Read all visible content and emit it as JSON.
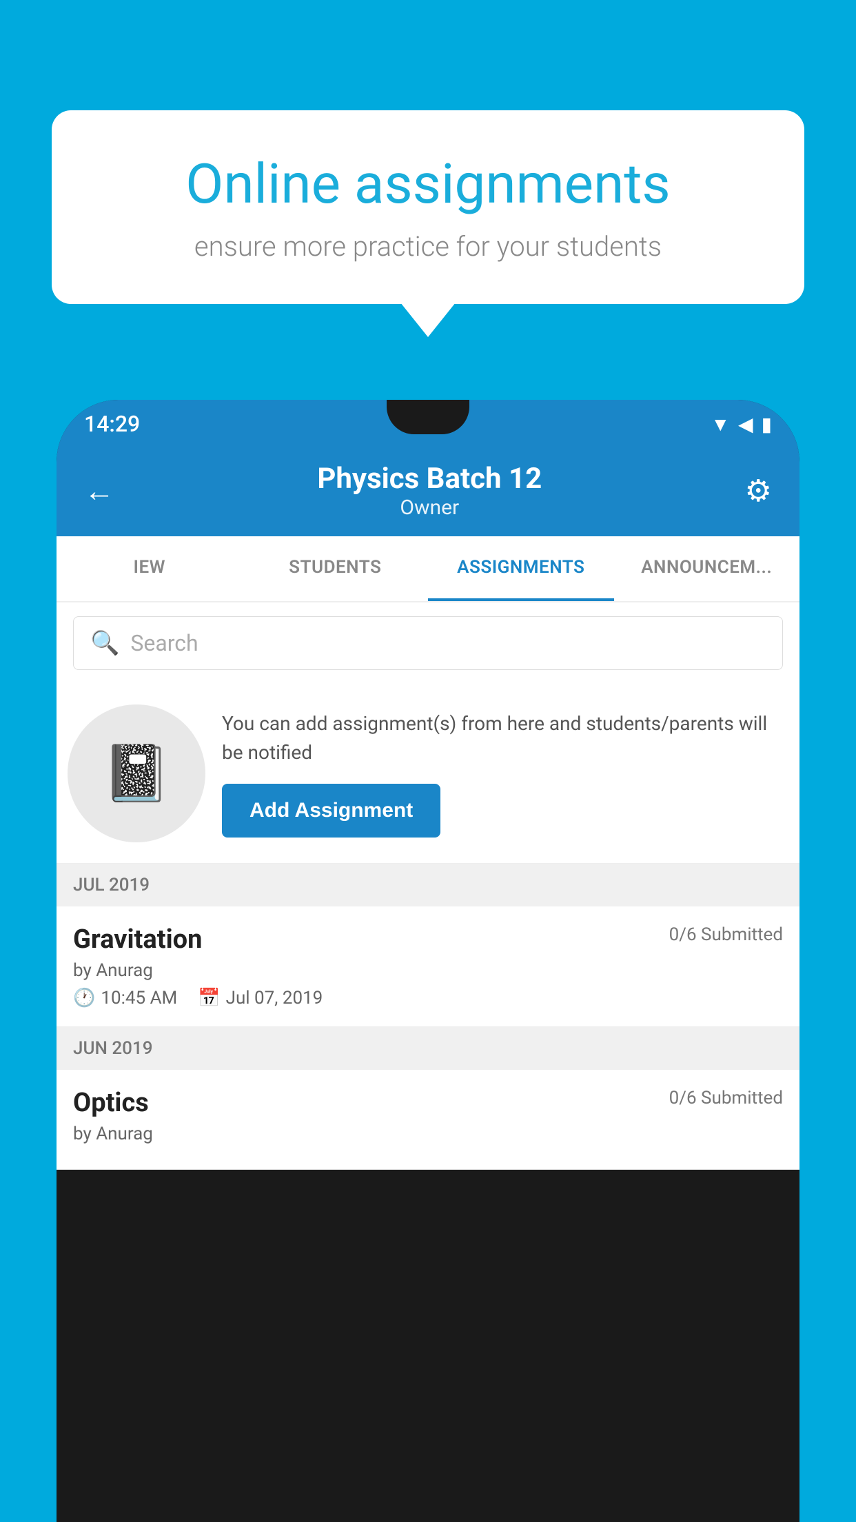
{
  "background_color": "#00AADD",
  "speech_bubble": {
    "title": "Online assignments",
    "subtitle": "ensure more practice for your students"
  },
  "status_bar": {
    "time": "14:29",
    "icons": [
      "wifi",
      "signal",
      "battery"
    ]
  },
  "header": {
    "title": "Physics Batch 12",
    "subtitle": "Owner"
  },
  "tabs": [
    {
      "label": "IEW",
      "active": false
    },
    {
      "label": "STUDENTS",
      "active": false
    },
    {
      "label": "ASSIGNMENTS",
      "active": true
    },
    {
      "label": "ANNOUNCEM...",
      "active": false
    }
  ],
  "search": {
    "placeholder": "Search"
  },
  "promo": {
    "description": "You can add assignment(s) from here and students/parents will be notified",
    "button_label": "Add Assignment"
  },
  "sections": [
    {
      "month": "JUL 2019",
      "assignments": [
        {
          "title": "Gravitation",
          "submitted": "0/6 Submitted",
          "author": "by Anurag",
          "time": "10:45 AM",
          "date": "Jul 07, 2019"
        }
      ]
    },
    {
      "month": "JUN 2019",
      "assignments": [
        {
          "title": "Optics",
          "submitted": "0/6 Submitted",
          "author": "by Anurag",
          "time": "",
          "date": ""
        }
      ]
    }
  ]
}
